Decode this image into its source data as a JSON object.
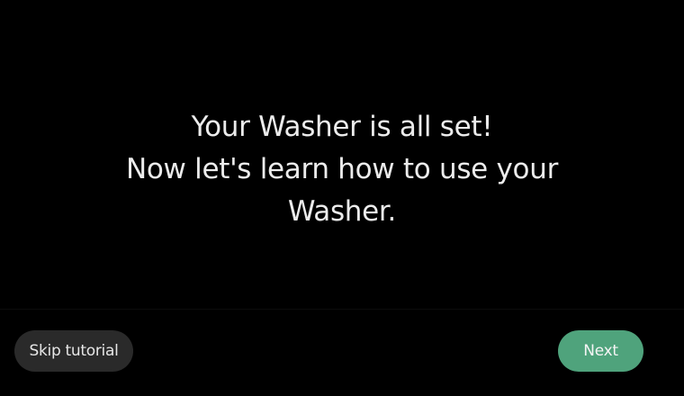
{
  "message": {
    "line1": "Your Washer is all set!",
    "line2": "Now let's learn how to use your",
    "line3": "Washer."
  },
  "footer": {
    "skip_label": "Skip tutorial",
    "next_label": "Next"
  },
  "colors": {
    "background": "#000000",
    "next_button": "#4fa37c",
    "skip_button": "#2a2a2a",
    "text": "#ececec"
  }
}
